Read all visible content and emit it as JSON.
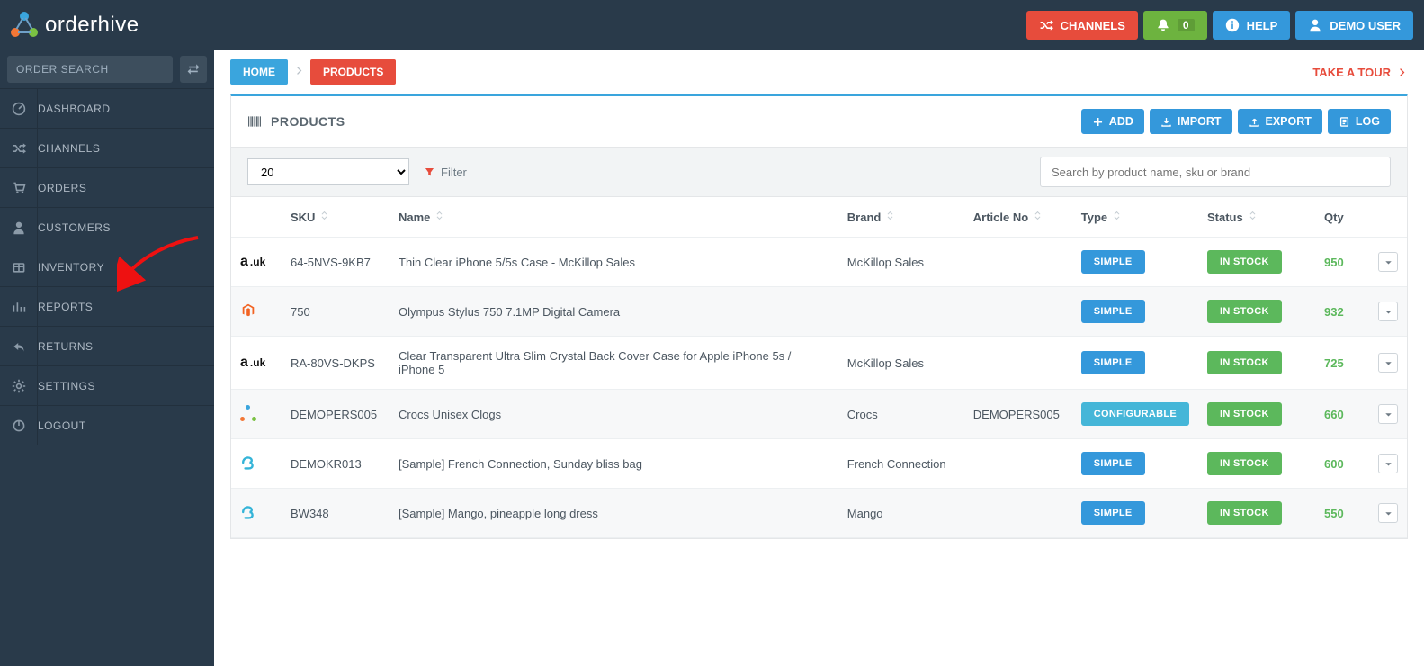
{
  "brand": "orderhive",
  "top": {
    "channels": "CHANNELS",
    "notif_count": "0",
    "help": "HELP",
    "user": "DEMO USER"
  },
  "search": {
    "placeholder": "ORDER SEARCH"
  },
  "nav": [
    "DASHBOARD",
    "CHANNELS",
    "ORDERS",
    "CUSTOMERS",
    "INVENTORY",
    "REPORTS",
    "RETURNS",
    "SETTINGS",
    "LOGOUT"
  ],
  "breadcrumb": {
    "home": "HOME",
    "current": "PRODUCTS",
    "tour": "TAKE A TOUR"
  },
  "panel": {
    "title": "PRODUCTS",
    "add": "ADD",
    "import": "IMPORT",
    "export": "EXPORT",
    "log": "LOG"
  },
  "toolbar": {
    "page_size": "20",
    "filter": "Filter",
    "search_placeholder": "Search by product name, sku or brand"
  },
  "columns": {
    "sku": "SKU",
    "name": "Name",
    "brand": "Brand",
    "article": "Article No",
    "type": "Type",
    "status": "Status",
    "qty": "Qty"
  },
  "type_labels": {
    "simple": "SIMPLE",
    "configurable": "CONFIGURABLE"
  },
  "status_labels": {
    "in_stock": "IN STOCK"
  },
  "rows": [
    {
      "channel": "amazon-uk",
      "sku": "64-5NVS-9KB7",
      "name": "Thin Clear iPhone 5/5s Case - McKillop Sales",
      "brand": "McKillop Sales",
      "article": "",
      "type": "simple",
      "status": "in_stock",
      "qty": "950"
    },
    {
      "channel": "magento",
      "sku": "750",
      "name": "Olympus Stylus 750 7.1MP Digital Camera",
      "brand": "",
      "article": "",
      "type": "simple",
      "status": "in_stock",
      "qty": "932"
    },
    {
      "channel": "amazon-uk",
      "sku": "RA-80VS-DKPS",
      "name": "Clear Transparent Ultra Slim Crystal Back Cover Case for Apple iPhone 5s / iPhone 5",
      "brand": "McKillop Sales",
      "article": "",
      "type": "simple",
      "status": "in_stock",
      "qty": "725"
    },
    {
      "channel": "orderhive",
      "sku": "DEMOPERS005",
      "name": "Crocs Unisex Clogs",
      "brand": "Crocs",
      "article": "DEMOPERS005",
      "type": "configurable",
      "status": "in_stock",
      "qty": "660"
    },
    {
      "channel": "bigcommerce",
      "sku": "DEMOKR013",
      "name": "[Sample] French Connection, Sunday bliss bag",
      "brand": "French Connection",
      "article": "",
      "type": "simple",
      "status": "in_stock",
      "qty": "600"
    },
    {
      "channel": "bigcommerce",
      "sku": "BW348",
      "name": "[Sample] Mango, pineapple long dress",
      "brand": "Mango",
      "article": "",
      "type": "simple",
      "status": "in_stock",
      "qty": "550"
    }
  ]
}
